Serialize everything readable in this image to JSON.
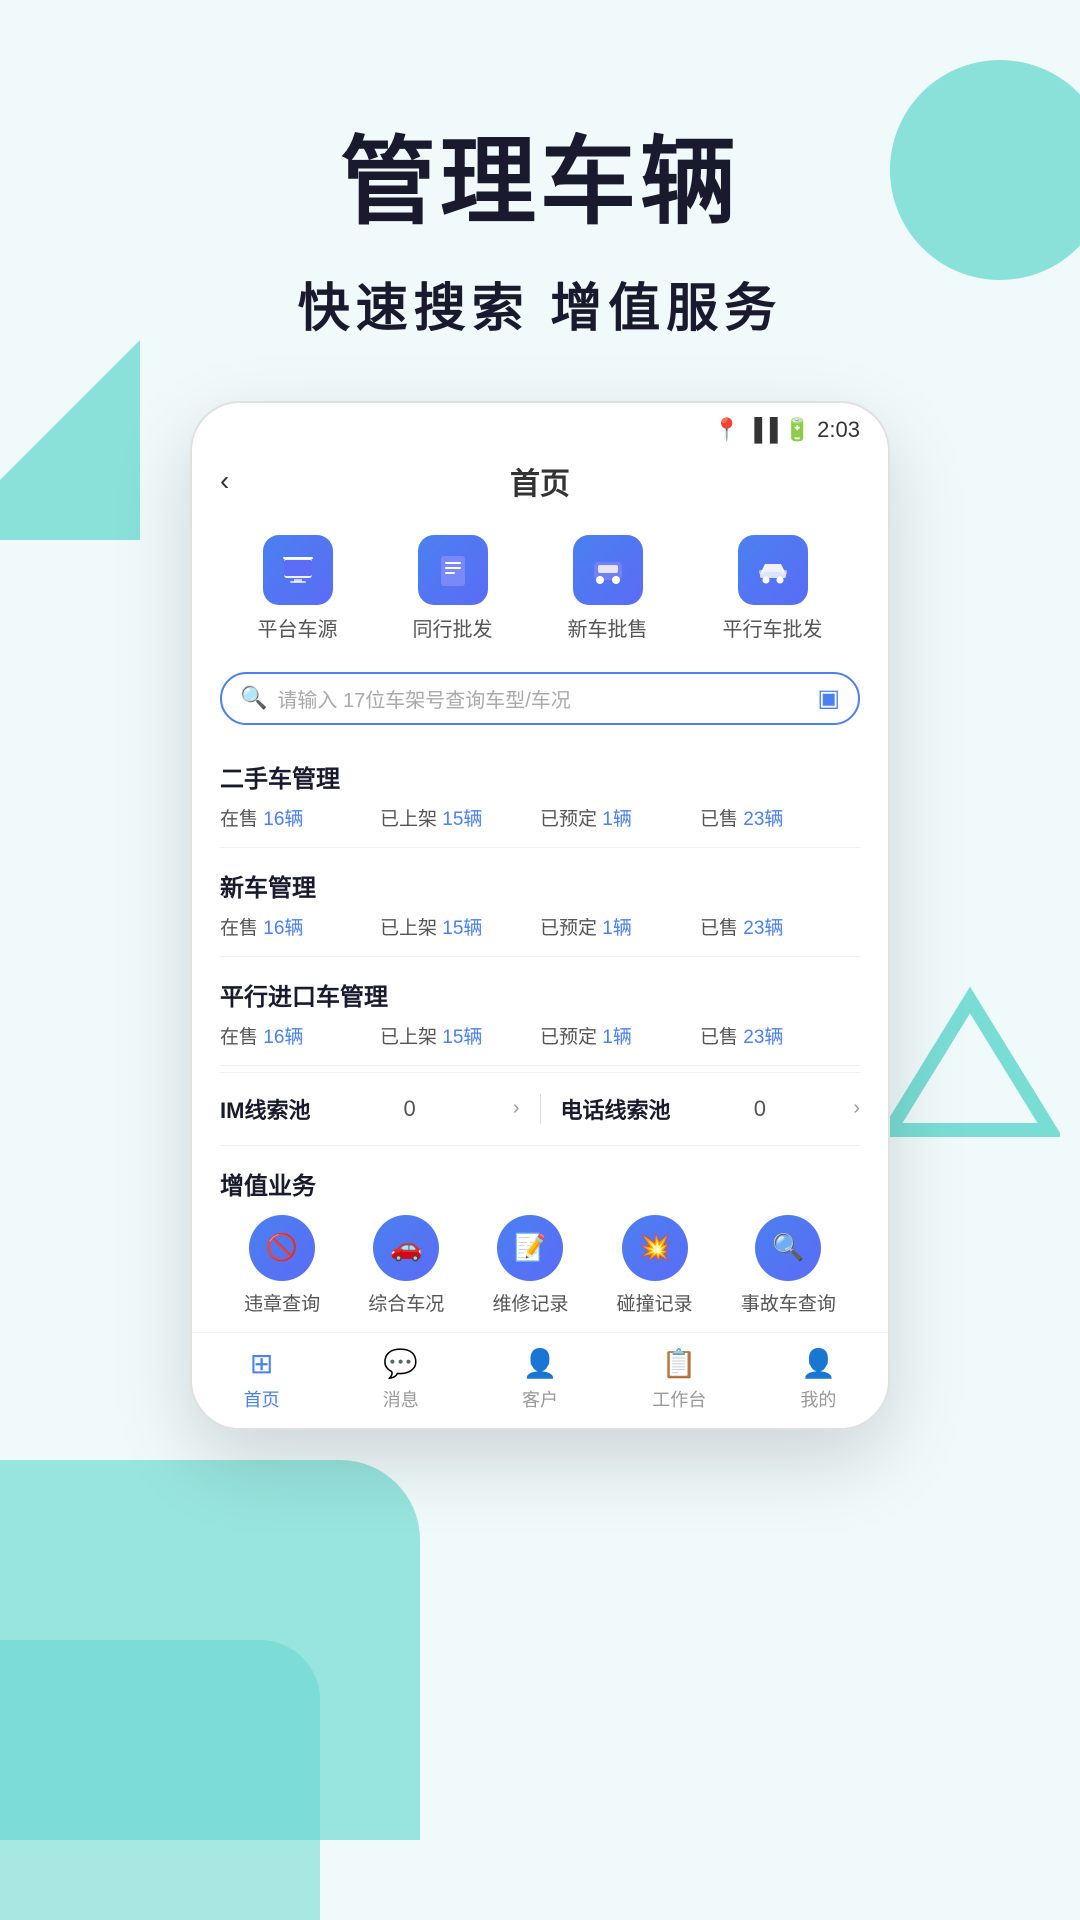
{
  "hero": {
    "title": "管理车辆",
    "subtitle": "快速搜索 增值服务"
  },
  "status_bar": {
    "time": "2:03"
  },
  "nav": {
    "back_label": "‹",
    "title": "首页"
  },
  "quick_icons": [
    {
      "label": "平台车源",
      "icon": "🖥"
    },
    {
      "label": "同行批发",
      "icon": "📋"
    },
    {
      "label": "新车批售",
      "icon": "🚗"
    },
    {
      "label": "平行车批发",
      "icon": "🚕"
    }
  ],
  "search": {
    "placeholder": "请输入 17位车架号查询车型/车况"
  },
  "sections": [
    {
      "title": "二手车管理",
      "stats": [
        {
          "label": "在售",
          "count": "16辆"
        },
        {
          "label": "已上架",
          "count": "15辆"
        },
        {
          "label": "已预定",
          "count": "1辆"
        },
        {
          "label": "已售",
          "count": "23辆"
        }
      ]
    },
    {
      "title": "新车管理",
      "stats": [
        {
          "label": "在售",
          "count": "16辆"
        },
        {
          "label": "已上架",
          "count": "15辆"
        },
        {
          "label": "已预定",
          "count": "1辆"
        },
        {
          "label": "已售",
          "count": "23辆"
        }
      ]
    },
    {
      "title": "平行进口车管理",
      "stats": [
        {
          "label": "在售",
          "count": "16辆"
        },
        {
          "label": "已上架",
          "count": "15辆"
        },
        {
          "label": "已预定",
          "count": "1辆"
        },
        {
          "label": "已售",
          "count": "23辆"
        }
      ]
    }
  ],
  "leads": {
    "im_label": "IM线索池",
    "im_count": "0",
    "phone_label": "电话线索池",
    "phone_count": "0"
  },
  "value_added": {
    "title": "增值业务",
    "items": [
      {
        "label": "违章查询",
        "icon": "🚫"
      },
      {
        "label": "综合车况",
        "icon": "🚗"
      },
      {
        "label": "维修记录",
        "icon": "📝"
      },
      {
        "label": "碰撞记录",
        "icon": "💥"
      },
      {
        "label": "事故车查询",
        "icon": "🔍"
      }
    ]
  },
  "tabs": [
    {
      "label": "首页",
      "icon": "⊞",
      "active": true
    },
    {
      "label": "消息",
      "icon": "💬",
      "active": false
    },
    {
      "label": "客户",
      "icon": "👤",
      "active": false
    },
    {
      "label": "工作台",
      "icon": "📋",
      "active": false
    },
    {
      "label": "我的",
      "icon": "👤",
      "active": false
    }
  ]
}
